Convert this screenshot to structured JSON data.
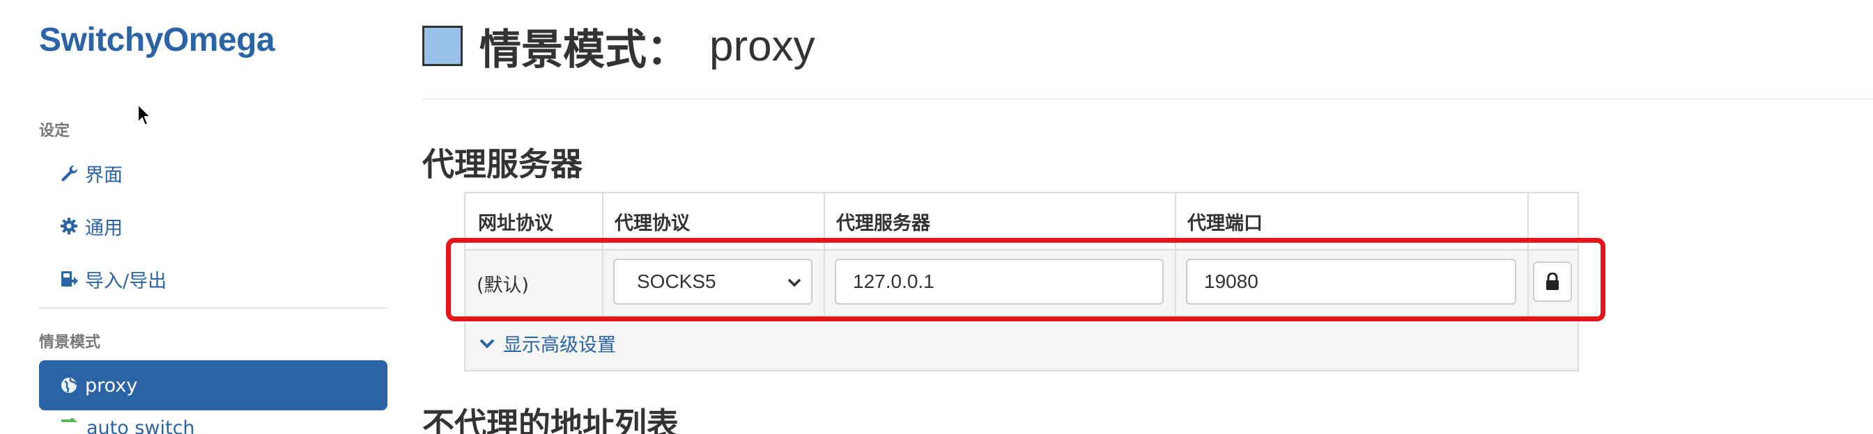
{
  "app": {
    "brand": "SwitchyOmega"
  },
  "sidebar": {
    "settings_header": "设定",
    "settings_items": [
      {
        "label": "界面",
        "icon": "wrench-icon"
      },
      {
        "label": "通用",
        "icon": "gear-icon"
      },
      {
        "label": "导入/导出",
        "icon": "import-export-icon"
      }
    ],
    "profiles_header": "情景模式",
    "profiles": [
      {
        "label": "proxy",
        "icon": "globe-icon",
        "active": true
      },
      {
        "label": "auto switch",
        "icon": "switch-icon",
        "active": false
      }
    ]
  },
  "page": {
    "title_prefix": "情景模式：",
    "profile_name": "proxy",
    "profile_color": "#99c2ea"
  },
  "proxy_servers": {
    "section_title": "代理服务器",
    "columns": [
      "网址协议",
      "代理协议",
      "代理服务器",
      "代理端口"
    ],
    "row": {
      "scheme": "(默认)",
      "protocol": "SOCKS5",
      "server": "127.0.0.1",
      "port": "19080"
    },
    "advanced_link": "显示高级设置"
  },
  "bypass": {
    "section_title": "不代理的地址列表"
  },
  "colors": {
    "accent": "#2a64a6",
    "highlight": "#e8141c"
  }
}
